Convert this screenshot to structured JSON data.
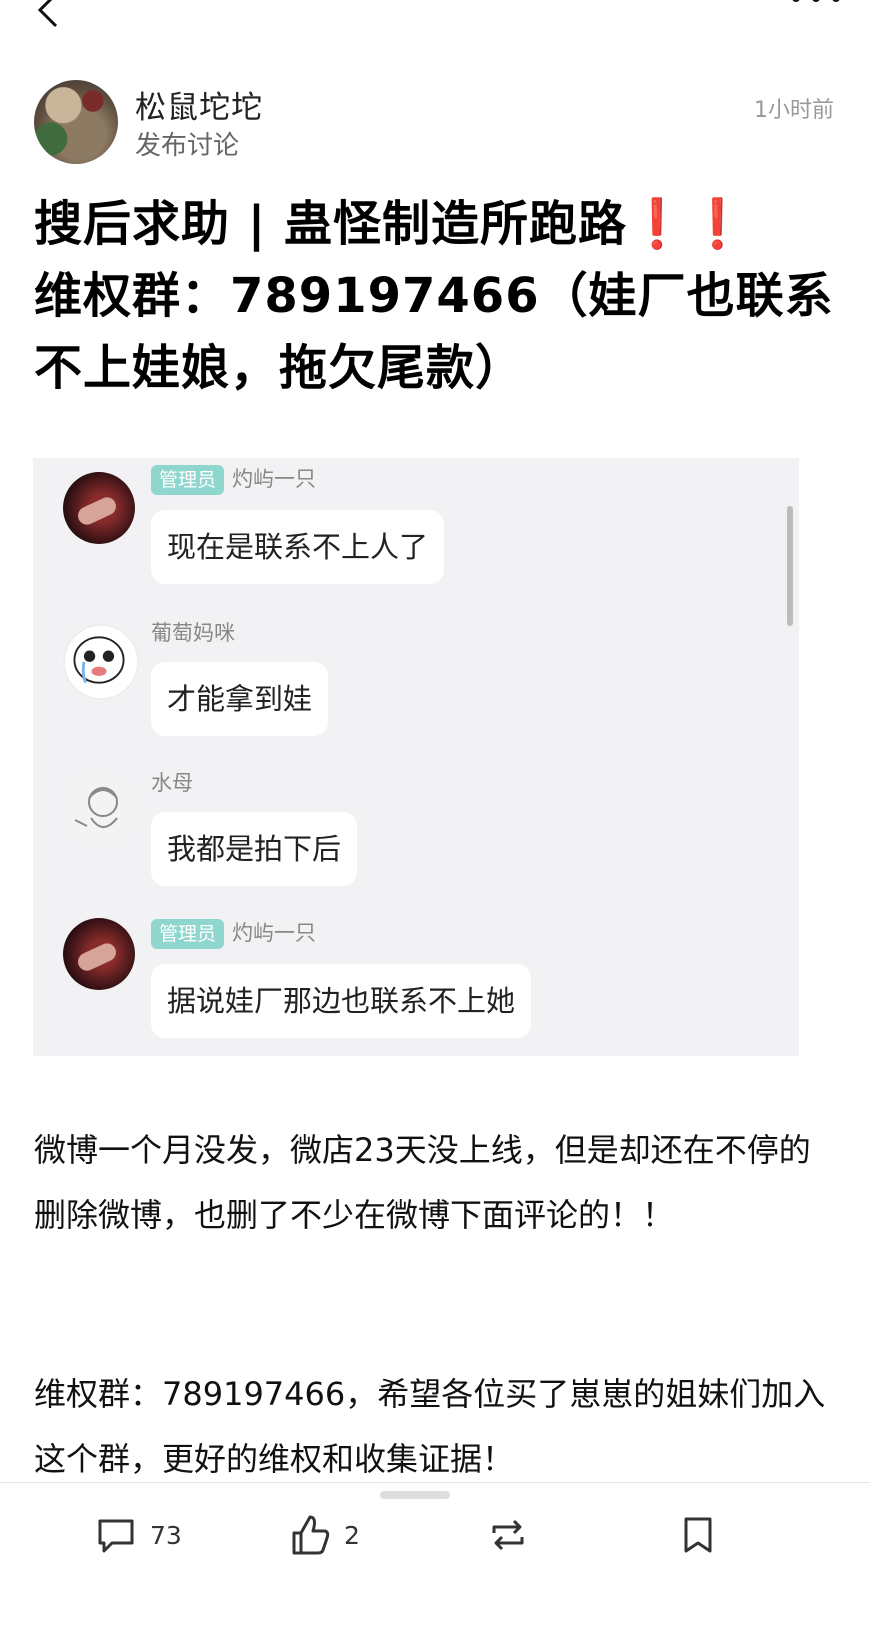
{
  "author": {
    "name": "松鼠坨坨",
    "subtitle": "发布讨论",
    "time": "1小时前"
  },
  "title": {
    "text": "搜后求助 | 蛊怪制造所跑路",
    "emoji": "❗️❗️",
    "line2": "维权群：789197466（娃厂也联系不上娃娘，拖欠尾款）"
  },
  "chat": {
    "messages": [
      {
        "badge": "管理员",
        "user": "灼屿一只",
        "text": "现在是联系不上人了"
      },
      {
        "badge": "",
        "user": "葡萄妈咪",
        "text": "才能拿到娃"
      },
      {
        "badge": "",
        "user": "水母",
        "text": "我都是拍下后"
      },
      {
        "badge": "管理员",
        "user": "灼屿一只",
        "text": "据说娃厂那边也联系不上她"
      }
    ]
  },
  "body": {
    "paragraph1": "微博一个月没发，微店23天没上线，但是却还在不停的删除微博，也删了不少在微博下面评论的！！",
    "paragraph2": "维权群：789197466，希望各位买了崽崽的姐妹们加入这个群，更好的维权和收集证据！"
  },
  "actions": {
    "comments": "73",
    "likes": "2",
    "repost": "",
    "bookmark": ""
  },
  "icons": [
    "back-icon",
    "more-icon",
    "comment-icon",
    "like-icon",
    "repost-icon",
    "bookmark-icon"
  ]
}
